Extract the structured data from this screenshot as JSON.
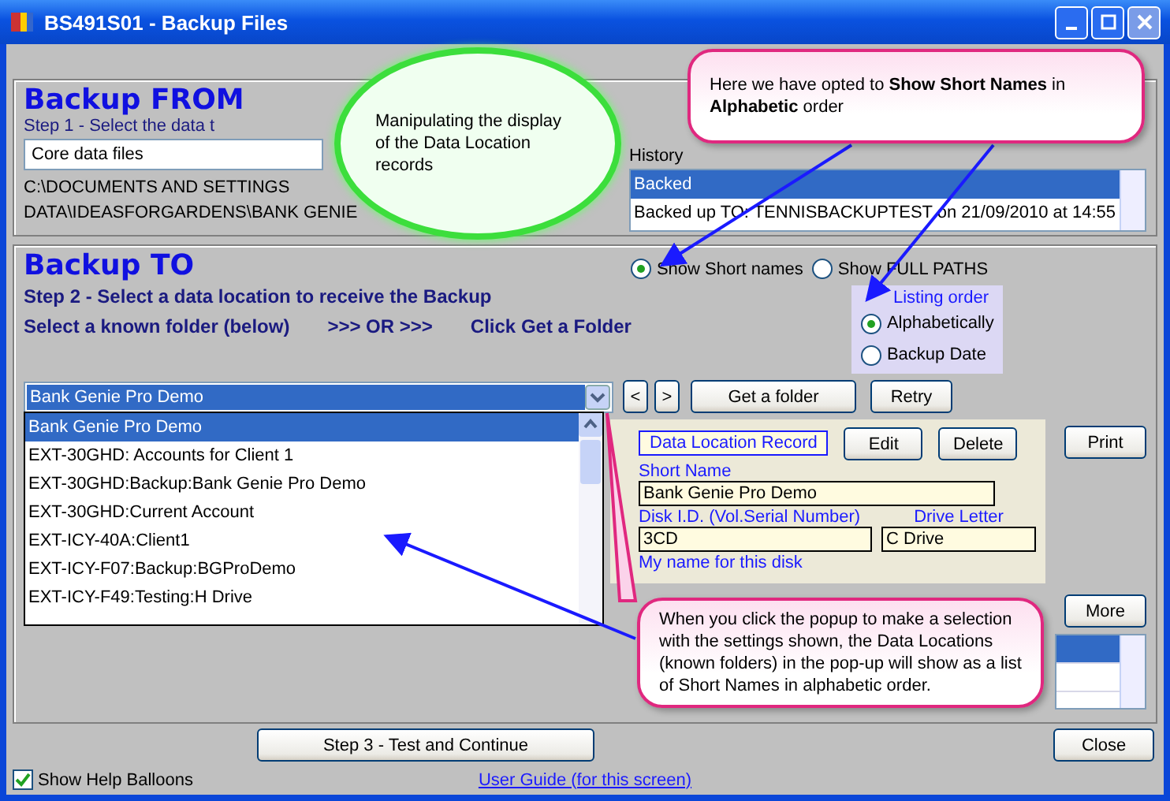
{
  "window": {
    "title": "BS491S01 - Backup Files"
  },
  "backup_from": {
    "heading": "Backup FROM",
    "step": "Step 1 - Select the data t",
    "source": {
      "value": "Core data files"
    },
    "path_lines": [
      "C:\\DOCUMENTS AND SETTINGS",
      "DATA\\IDEASFORGARDENS\\BANK GENIE"
    ],
    "history": {
      "label": "History",
      "rows": [
        {
          "text": "Backed",
          "selected": true
        },
        {
          "text": "Backed up TO: TENNISBACKUPTEST on 21/09/2010 at 14:55",
          "selected": false
        }
      ]
    }
  },
  "backup_to": {
    "heading": "Backup TO",
    "display_options": [
      {
        "label": "Show Short names",
        "selected": true
      },
      {
        "label": "Show FULL PATHS",
        "selected": false
      }
    ],
    "step": "Step 2 - Select a data location to receive the Backup",
    "instruction": [
      "Select a known folder (below)",
      ">>> OR >>>",
      "Click Get a Folder"
    ],
    "listing_order": {
      "title": "Listing order",
      "options": [
        {
          "label": "Alphabetically",
          "selected": true
        },
        {
          "label": "Backup Date",
          "selected": false
        }
      ]
    },
    "known_folder": {
      "value": "Bank Genie Pro Demo",
      "options": [
        {
          "text": "Bank Genie Pro Demo",
          "selected": true
        },
        {
          "text": "EXT-30GHD: Accounts for Client 1",
          "selected": false
        },
        {
          "text": "EXT-30GHD:Backup:Bank Genie Pro Demo",
          "selected": false
        },
        {
          "text": "EXT-30GHD:Current Account",
          "selected": false
        },
        {
          "text": "EXT-ICY-40A:Client1",
          "selected": false
        },
        {
          "text": "EXT-ICY-F07:Backup:BGProDemo",
          "selected": false
        },
        {
          "text": "EXT-ICY-F49:Testing:H Drive",
          "selected": false
        }
      ]
    },
    "nav_buttons": [
      "<",
      ">",
      "Get a folder",
      "Retry"
    ],
    "record": {
      "title": "Data Location Record",
      "buttons": [
        "Edit",
        "Delete"
      ],
      "fields": [
        {
          "label": "Short Name",
          "value": "Bank Genie Pro Demo"
        },
        {
          "label": "Disk I.D. (Vol.Serial Number)",
          "value": "3CD"
        },
        {
          "label": "Drive Letter",
          "value": "C Drive"
        }
      ],
      "note": "My name for this disk"
    },
    "side_buttons": [
      "Print",
      "More"
    ],
    "lower_list": {
      "rows": [
        {
          "selected": true
        },
        {
          "selected": false
        }
      ]
    }
  },
  "footer": {
    "continue_button": "Step 3 - Test and Continue",
    "close_button": "Close",
    "help_balloons": {
      "label": "Show Help Balloons",
      "checked": true
    },
    "link": "User Guide (for this screen)"
  },
  "balloons": [
    {
      "kind": "cloud",
      "text": "Manipulating the display of the Data Location records"
    },
    {
      "kind": "note",
      "text": "Here we have opted to **Show Short Names** in **Alphabetic** order"
    },
    {
      "kind": "note",
      "text": "When you click the popup to make a selection with the settings shown, the Data Locations (known folders) in the pop-up will show as a list of Short Names in alphabetic order."
    }
  ]
}
